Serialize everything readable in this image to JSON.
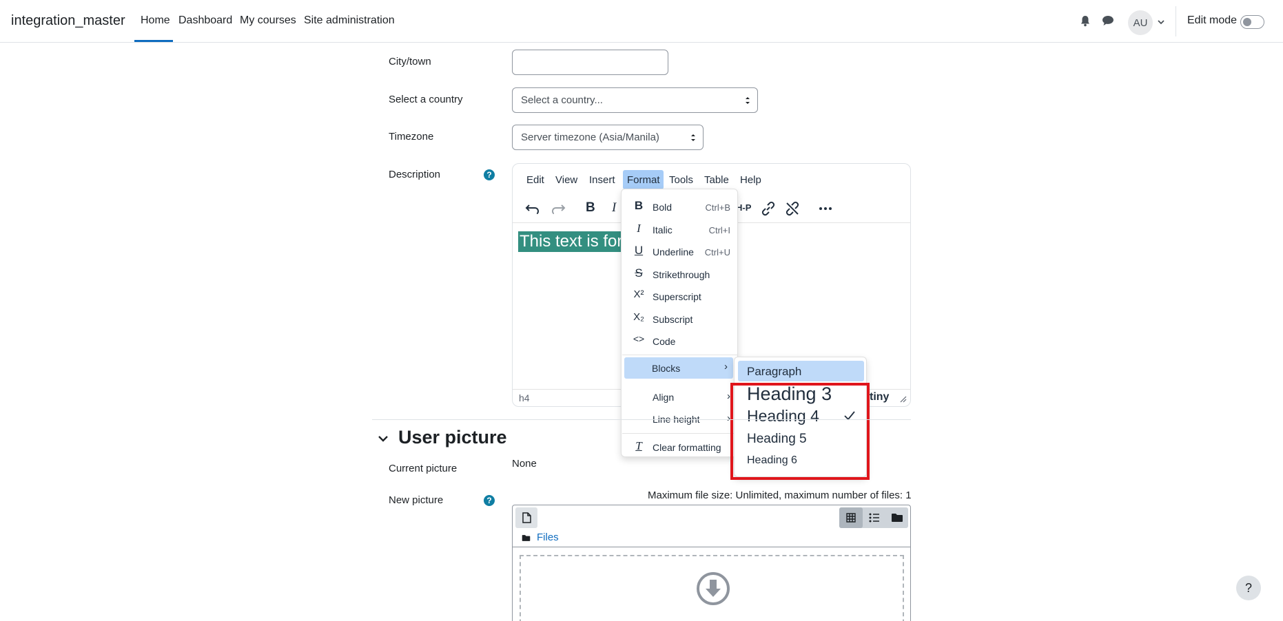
{
  "navbar": {
    "brand": "integration_master",
    "links": [
      "Home",
      "Dashboard",
      "My courses",
      "Site administration"
    ],
    "avatar_initials": "AU",
    "edit_mode_label": "Edit mode"
  },
  "form": {
    "city_label": "City/town",
    "city_value": "",
    "country_label": "Select a country",
    "country_value": "Select a country...",
    "timezone_label": "Timezone",
    "timezone_value": "Server timezone (Asia/Manila)",
    "description_label": "Description"
  },
  "editor": {
    "menubar": [
      "Edit",
      "View",
      "Insert",
      "Format",
      "Tools",
      "Table",
      "Help"
    ],
    "content_text": "This text is for",
    "status_path": "h4",
    "logo": "tiny"
  },
  "format_menu": {
    "items": [
      {
        "icon": "B",
        "label": "Bold",
        "shortcut": "Ctrl+B"
      },
      {
        "icon": "I",
        "label": "Italic",
        "shortcut": "Ctrl+I"
      },
      {
        "icon": "U",
        "label": "Underline",
        "shortcut": "Ctrl+U"
      },
      {
        "icon": "S",
        "label": "Strikethrough",
        "shortcut": ""
      },
      {
        "icon": "X²",
        "label": "Superscript",
        "shortcut": ""
      },
      {
        "icon": "X₂",
        "label": "Subscript",
        "shortcut": ""
      },
      {
        "icon": "<>",
        "label": "Code",
        "shortcut": ""
      }
    ],
    "submenus": [
      "Blocks",
      "Align",
      "Line height"
    ],
    "clear_formatting": "Clear formatting"
  },
  "blocks_menu": {
    "items": [
      "Paragraph",
      "Heading 3",
      "Heading 4",
      "Heading 5",
      "Heading 6"
    ],
    "checked": "Heading 4"
  },
  "user_picture": {
    "title": "User picture",
    "current_label": "Current picture",
    "current_value": "None",
    "new_label": "New picture",
    "max_size": "Maximum file size: Unlimited, maximum number of files: 1",
    "files_label": "Files"
  },
  "help_button": "?"
}
